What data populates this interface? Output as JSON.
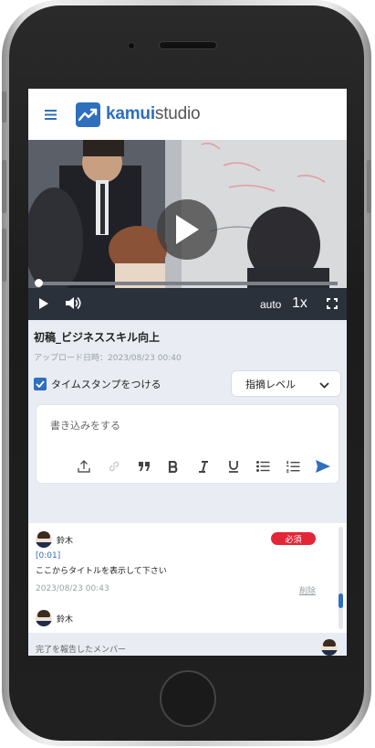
{
  "app": {
    "logo_part1": "kamui",
    "logo_part2": "studio"
  },
  "video": {
    "quality": "auto",
    "speed": "1x",
    "progress": 0.0
  },
  "meta": {
    "title": "初稿_ビジネススキル向上",
    "upload_date": "アップロード日時：2023/08/23 00:40"
  },
  "timestamp_option": {
    "label": "タイムスタンプをつける",
    "checked": true
  },
  "level_dropdown": {
    "label": "指摘レベル"
  },
  "editor": {
    "placeholder": "書き込みをする"
  },
  "comments": [
    {
      "user": "鈴木",
      "badge": "必須",
      "timestamp": "[0:01]",
      "body": "ここからタイトルを表示して下さい",
      "date": "2023/08/23 00:43",
      "delete_label": "削除"
    },
    {
      "user": "鈴木"
    }
  ],
  "footer": {
    "label": "完了を報告したメンバー"
  },
  "colors": {
    "accent": "#2f6fbe",
    "badge": "#e32637",
    "controls_bg": "#2b313b"
  },
  "icons": [
    "menu-icon",
    "logo-icon",
    "play-icon",
    "volume-icon",
    "fullscreen-icon",
    "checkbox-icon",
    "chevron-down-icon",
    "upload-icon",
    "link-icon",
    "quote-icon",
    "bold-icon",
    "italic-icon",
    "underline-icon",
    "bullet-list-icon",
    "numbered-list-icon",
    "send-icon"
  ]
}
